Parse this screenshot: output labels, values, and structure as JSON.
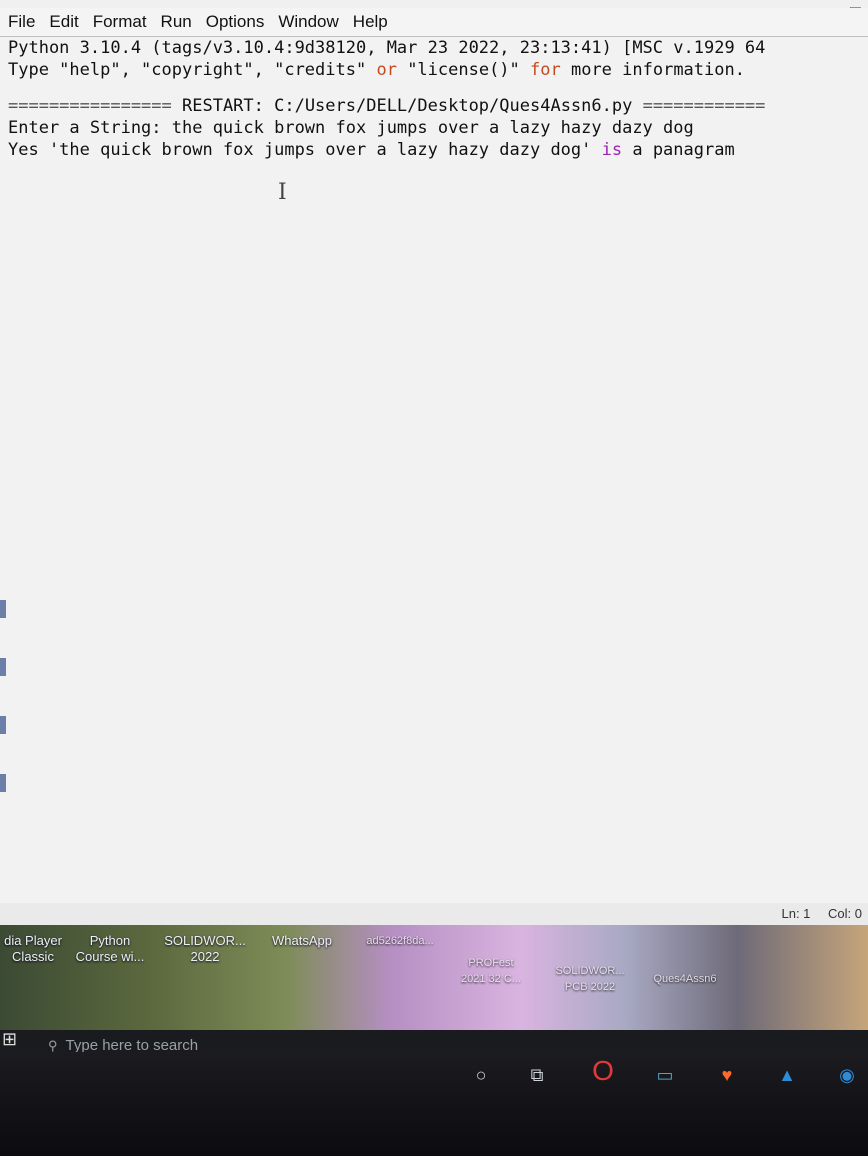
{
  "window": {
    "controls": {
      "minimize": "—",
      "maximize": "☐"
    },
    "menu": [
      "File",
      "Edit",
      "Format",
      "Run",
      "Options",
      "Window",
      "Help"
    ]
  },
  "shell": {
    "banner_line1": "Python 3.10.4 (tags/v3.10.4:9d38120, Mar 23 2022, 23:13:41) [MSC v.1929 64",
    "banner_line2_a": "Type \"help\", \"copyright\", \"credits\" ",
    "banner_line2_or": "or",
    "banner_line2_b": " \"license()\" ",
    "banner_line2_for": "for",
    "banner_line2_c": " more information.",
    "restart_rule_left": "================",
    "restart_text": " RESTART: C:/Users/DELL/Desktop/Ques4Assn6.py ",
    "restart_rule_right": "============",
    "prompt_line": "Enter a String: the quick brown fox jumps over a lazy hazy dazy dog",
    "output_a": "Yes 'the quick brown fox jumps over a lazy hazy dazy dog' ",
    "output_is": "is",
    "output_b": " a panagram",
    "cursor": "I"
  },
  "status": {
    "line": "Ln: 1",
    "col": "Col: 0"
  },
  "desktop": {
    "icons": [
      {
        "label": "dia Player\nClassic"
      },
      {
        "label": "Python\nCourse wi..."
      },
      {
        "label": "SOLIDWOR...\n2022"
      },
      {
        "label": "WhatsApp"
      },
      {
        "label": "ad5262f8da..."
      },
      {
        "label": "PROFest\n2021 32 C..."
      },
      {
        "label": "SOLIDWOR...\nPCB 2022"
      },
      {
        "label": "Ques4Assn6"
      }
    ]
  },
  "taskbar": {
    "search_placeholder": "Type here to search",
    "icons": [
      "start-icon",
      "cortana-icon",
      "task-view-icon",
      "opera-icon",
      "folder-icon",
      "brave-icon",
      "photos-icon",
      "chat-icon"
    ]
  }
}
